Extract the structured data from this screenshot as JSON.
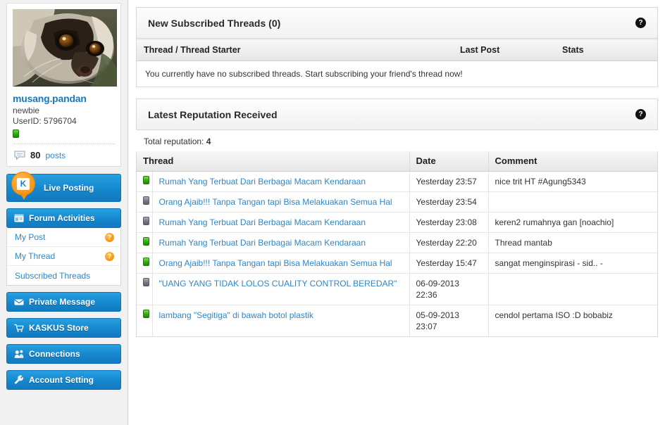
{
  "sidebar": {
    "profile": {
      "avatar_alt": "civet-avatar",
      "username": "musang.pandan",
      "rank": "newbie",
      "userid_label": "UserID: 5796704",
      "reputation_indicator": "green-reputation-bar",
      "posts_count": "80",
      "posts_label": "posts",
      "posts_icon": "speech-bubble-icon"
    },
    "live_posting": {
      "label": "Live Posting",
      "pin_icon": "kaskus-pin-icon",
      "pin_letter": "K"
    },
    "forum_activities": {
      "label": "Forum Activities",
      "icon": "grid-panel-icon",
      "items": [
        {
          "label": "My Post",
          "badge": "?"
        },
        {
          "label": "My Thread",
          "badge": "?"
        },
        {
          "label": "Subscribed Threads",
          "badge": ""
        }
      ]
    },
    "nav_buttons": [
      {
        "label": "Private Message",
        "icon": "envelope-icon"
      },
      {
        "label": "KASKUS Store",
        "icon": "shopping-cart-icon"
      },
      {
        "label": "Connections",
        "icon": "connections-icon"
      },
      {
        "label": "Account Setting",
        "icon": "wrench-icon"
      }
    ]
  },
  "subscribed_panel": {
    "title": "New Subscribed Threads (0)",
    "help_icon": "?",
    "columns": [
      "Thread / Thread Starter",
      "Last Post",
      "Stats"
    ],
    "empty_message": "You currently have no subscribed threads. Start subscribing your friend's thread now!"
  },
  "reputation_panel": {
    "title": "Latest Reputation Received",
    "help_icon": "?",
    "total_label": "Total reputation:",
    "total_value": "4",
    "columns": [
      "Thread",
      "Date",
      "Comment"
    ],
    "rows": [
      {
        "type": "pos",
        "thread": "Rumah Yang Terbuat Dari Berbagai Macam Kendaraan",
        "date": "Yesterday 23:57",
        "comment": "nice trit HT #Agung5343"
      },
      {
        "type": "neu",
        "thread": "Orang Ajaib!!! Tanpa Tangan tapi Bisa Melakuakan Semua Hal",
        "date": "Yesterday 23:54",
        "comment": ""
      },
      {
        "type": "neu",
        "thread": "Rumah Yang Terbuat Dari Berbagai Macam Kendaraan",
        "date": "Yesterday 23:08",
        "comment": "keren2 rumahnya gan [noachio]"
      },
      {
        "type": "pos",
        "thread": "Rumah Yang Terbuat Dari Berbagai Macam Kendaraan",
        "date": "Yesterday 22:20",
        "comment": "Thread mantab"
      },
      {
        "type": "pos",
        "thread": "Orang Ajaib!!! Tanpa Tangan tapi Bisa Melakuakan Semua Hal",
        "date": "Yesterday 15:47",
        "comment": "sangat menginspirasi - sid.. -"
      },
      {
        "type": "neu",
        "thread": "\"UANG YANG TIDAK LOLOS CUALITY CONTROL BEREDAR\"",
        "date": "06-09-2013 22:36",
        "comment": ""
      },
      {
        "type": "pos",
        "thread": "lambang \"Segitiga\" di bawah botol plastik",
        "date": "05-09-2013 23:07",
        "comment": "cendol pertama ISO :D bobabiz"
      }
    ]
  },
  "colors": {
    "accent_blue": "#1687ce",
    "link_blue": "#2f86c7",
    "orange": "#f79a1c",
    "positive_green": "#32ab0b",
    "neutral_gray": "#787888",
    "sidebar_bg": "#f1f1f1"
  }
}
